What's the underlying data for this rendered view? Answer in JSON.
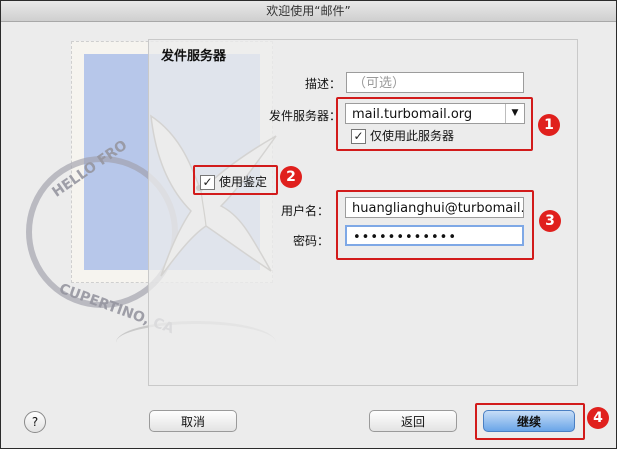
{
  "window": {
    "title": "欢迎使用“邮件”"
  },
  "panel": {
    "title": "发件服务器"
  },
  "form": {
    "description": {
      "label": "描述：",
      "placeholder": "（可选）"
    },
    "outgoing_server": {
      "label": "发件服务器：",
      "value": "mail.turbomail.org"
    },
    "only_this_server": {
      "label": "仅使用此服务器",
      "checked": true
    },
    "use_authentication": {
      "label": "使用鉴定",
      "checked": true
    },
    "username": {
      "label": "用户名：",
      "value": "huanglianghui@turbomail."
    },
    "password": {
      "label": "密码：",
      "value": "••••••••••••"
    }
  },
  "buttons": {
    "help": "?",
    "cancel": "取消",
    "back": "返回",
    "continue": "继续"
  },
  "badges": [
    "1",
    "2",
    "3",
    "4"
  ],
  "colors": {
    "accent": "#e0201d",
    "primary_button": "#6aa5e8",
    "stamp": "#b7c7ea"
  },
  "decor": {
    "postmark_line1": "HELLO FRO",
    "postmark_line2": "CUPERTINO, CA"
  }
}
